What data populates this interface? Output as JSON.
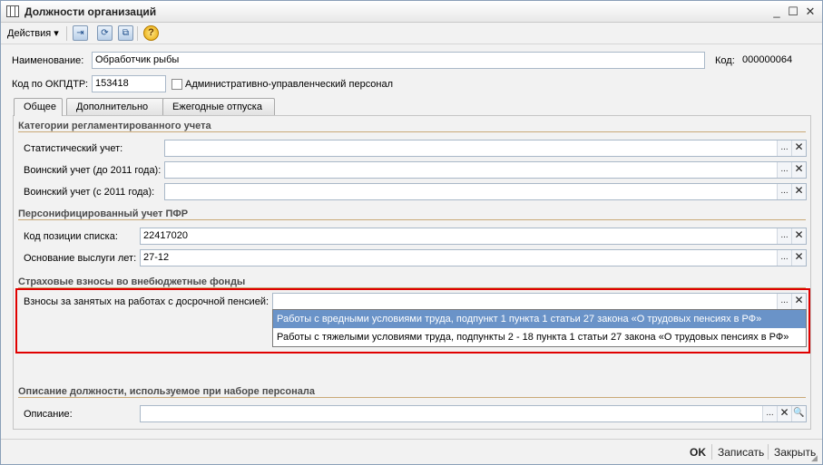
{
  "window": {
    "title": "Должности организаций",
    "minimize": "_",
    "maximize": "☐",
    "close": "✕"
  },
  "toolbar": {
    "actions_label": "Действия ▾",
    "help": "?"
  },
  "header": {
    "name_label": "Наименование:",
    "name_value": "Обработчик рыбы",
    "code_label": "Код:",
    "code_value": "000000064",
    "okpdtr_label": "Код по ОКПДТР:",
    "okpdtr_value": "153418",
    "admin_staff_label": "Административно-управленческий персонал"
  },
  "tabs": [
    {
      "label": "Общее"
    },
    {
      "label": "Дополнительно"
    },
    {
      "label": "Ежегодные отпуска"
    }
  ],
  "sections": {
    "categories": {
      "title": "Категории регламентированного учета",
      "stat_label": "Статистический учет:",
      "mil_before_label": "Воинский учет (до 2011 года):",
      "mil_after_label": "Воинский учет (с 2011 года):"
    },
    "pfr": {
      "title": "Персонифицированный учет ПФР",
      "position_code_label": "Код позиции списка:",
      "position_code_value": "22417020",
      "seniority_label": "Основание выслуги лет:",
      "seniority_value": "27-12"
    },
    "insurance": {
      "title": "Страховые взносы во внебюджетные фонды",
      "early_pension_label": "Взносы за занятых на работах с досрочной пенсией:",
      "options": [
        "Работы с вредными условиями труда, подпункт 1 пункта 1 статьи 27 закона «О трудовых пенсиях в РФ»",
        "Работы с тяжелыми условиями труда, подпункты 2 - 18 пункта 1 статьи 27 закона «О трудовых пенсиях в РФ»"
      ]
    },
    "description": {
      "title": "Описание должности, используемое при наборе персонала",
      "description_label": "Описание:"
    }
  },
  "field_buttons": {
    "select": "...",
    "clear": "✕",
    "search": "🔍"
  },
  "footer": {
    "ok": "OK",
    "save": "Записать",
    "close": "Закрыть"
  }
}
